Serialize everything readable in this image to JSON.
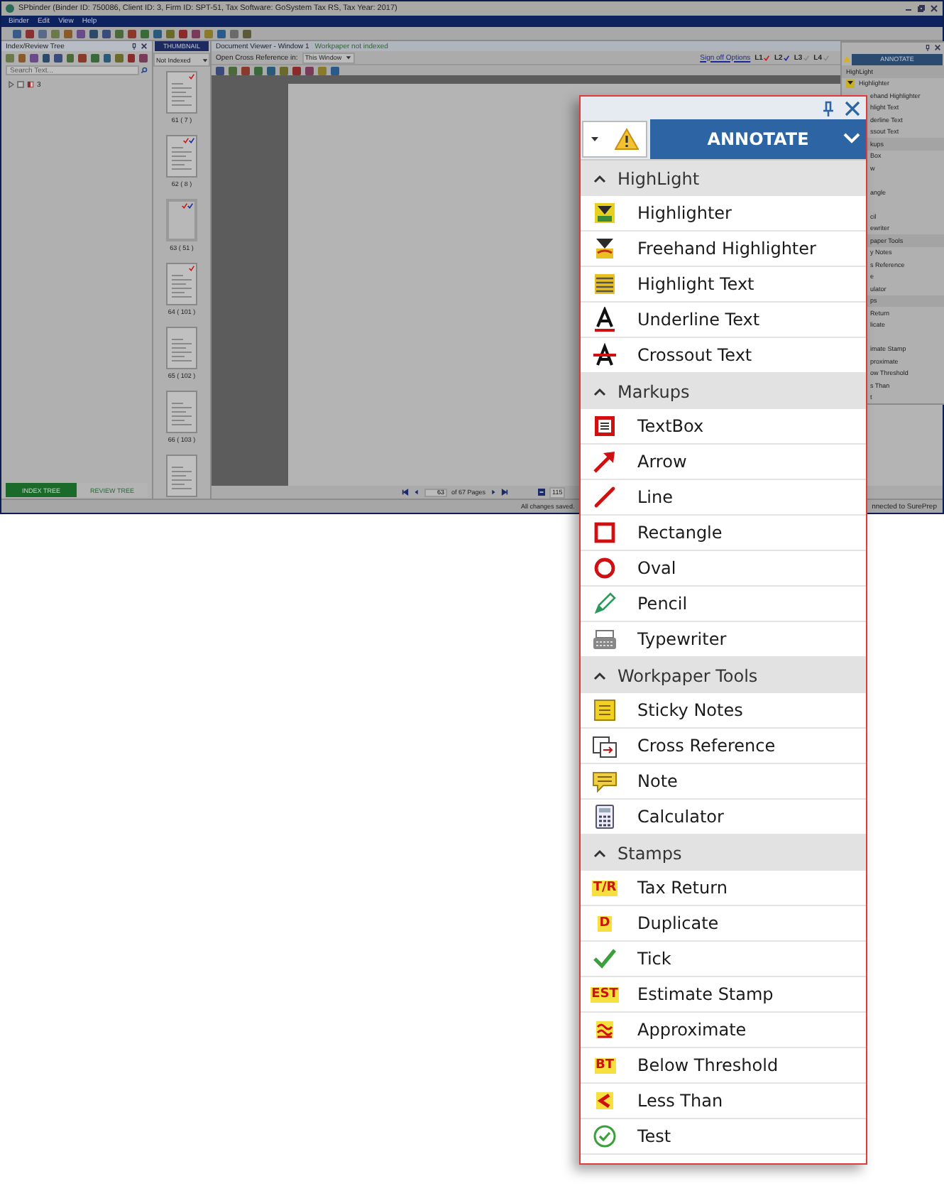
{
  "window": {
    "title": "SPbinder (Binder ID: 750086, Client ID: 3, Firm ID: SPT-51, Tax Software: GoSystem Tax RS, Tax Year: 2017)"
  },
  "menu": [
    "Binder",
    "Edit",
    "View",
    "Help"
  ],
  "index_panel": {
    "title": "Index/Review Tree",
    "search": {
      "placeholder": "Search Text..."
    },
    "tree": [
      {
        "label": "3",
        "expanded": false,
        "checked": false
      }
    ],
    "tabs": [
      {
        "label": "INDEX TREE",
        "selected": true
      },
      {
        "label": "REVIEW TREE",
        "selected": false
      }
    ]
  },
  "thumbnail_panel": {
    "tab": "THUMBNAIL",
    "filter": "Not Indexed",
    "thumbnails": [
      {
        "label": "61 ( 7 )",
        "blank": false,
        "checks": [
          {
            "color": "#c81818"
          }
        ]
      },
      {
        "label": "62 ( 8 )",
        "blank": false,
        "checks": [
          {
            "color": "#c81818"
          },
          {
            "color": "#1a2a9a"
          }
        ]
      },
      {
        "label": "63 ( 51 )",
        "blank": true,
        "checks": [
          {
            "color": "#c81818"
          },
          {
            "color": "#1a2a9a"
          }
        ]
      },
      {
        "label": "64 ( 101 )",
        "blank": false,
        "checks": [
          {
            "color": "#c81818"
          }
        ]
      },
      {
        "label": "65 ( 102 )",
        "blank": false
      },
      {
        "label": "66 ( 103 )",
        "blank": false
      },
      {
        "blank": false
      }
    ]
  },
  "viewer": {
    "title": "Document Viewer - Window 1",
    "status": "Workpaper not indexed",
    "cross_ref_label": "Open Cross Reference in:",
    "cross_ref_value": "This Window",
    "signoff_link": "Sign off Options",
    "signoffs": [
      {
        "label": "L1",
        "color": "#c81818"
      },
      {
        "label": "L2",
        "color": "#1a2a9a"
      },
      {
        "label": "L3",
        "color": "#8a8a8a"
      },
      {
        "label": "L4",
        "color": "#8a8a8a"
      }
    ],
    "page": "63",
    "page_of": "of  67 Pages",
    "zoom": "115"
  },
  "status_bar": {
    "message": "All changes saved.",
    "connection": "nnected to SurePrep"
  },
  "mini_panel": {
    "button": "ANNOTATE",
    "rows": [
      {
        "kind": "header",
        "text": "HighLight"
      },
      {
        "kind": "item",
        "text": "Highlighter"
      },
      {
        "kind": "item",
        "text": "ehand Highlighter"
      },
      {
        "kind": "item",
        "text": "hlight Text"
      },
      {
        "kind": "item",
        "text": "derline Text"
      },
      {
        "kind": "item",
        "text": "ssout Text"
      },
      {
        "kind": "header",
        "text": "kups"
      },
      {
        "kind": "item",
        "text": "Box"
      },
      {
        "kind": "item",
        "text": "w"
      },
      {
        "kind": "item"
      },
      {
        "kind": "item",
        "text": "angle"
      },
      {
        "kind": "item"
      },
      {
        "kind": "item",
        "text": "cil"
      },
      {
        "kind": "item",
        "text": "ewriter"
      },
      {
        "kind": "header",
        "text": "paper Tools"
      },
      {
        "kind": "item",
        "text": "y Notes"
      },
      {
        "kind": "item",
        "text": "s Reference"
      },
      {
        "kind": "item",
        "text": "e"
      },
      {
        "kind": "item",
        "text": "ulator"
      },
      {
        "kind": "header",
        "text": "ps"
      },
      {
        "kind": "item",
        "text": "Return"
      },
      {
        "kind": "item",
        "text": "licate"
      },
      {
        "kind": "item"
      },
      {
        "kind": "item",
        "text": "imate Stamp"
      },
      {
        "kind": "item",
        "text": "proximate"
      },
      {
        "kind": "item",
        "text": "ow Threshold"
      },
      {
        "kind": "item",
        "text": "s Than"
      },
      {
        "kind": "item",
        "text": "t"
      }
    ]
  },
  "annotate_panel": {
    "button": "ANNOTATE",
    "sections": [
      {
        "title": "HighLight",
        "expanded": true,
        "items": [
          {
            "label": "Highlighter"
          },
          {
            "label": "Freehand Highlighter"
          },
          {
            "label": "Highlight Text"
          },
          {
            "label": "Underline Text"
          },
          {
            "label": "Crossout Text"
          }
        ]
      },
      {
        "title": "Markups",
        "expanded": true,
        "items": [
          {
            "label": "TextBox"
          },
          {
            "label": "Arrow"
          },
          {
            "label": "Line"
          },
          {
            "label": "Rectangle"
          },
          {
            "label": "Oval"
          },
          {
            "label": "Pencil"
          },
          {
            "label": "Typewriter"
          }
        ]
      },
      {
        "title": "Workpaper Tools",
        "expanded": true,
        "items": [
          {
            "label": "Sticky Notes"
          },
          {
            "label": "Cross Reference"
          },
          {
            "label": "Note"
          },
          {
            "label": "Calculator"
          }
        ]
      },
      {
        "title": "Stamps",
        "expanded": true,
        "items": [
          {
            "label": "Tax Return",
            "stamp": "T/R"
          },
          {
            "label": "Duplicate",
            "stamp": "D"
          },
          {
            "label": "Tick"
          },
          {
            "label": "Estimate Stamp",
            "stamp": "EST"
          },
          {
            "label": "Approximate"
          },
          {
            "label": "Below Threshold",
            "stamp": "BT"
          },
          {
            "label": "Less Than"
          },
          {
            "label": "Test"
          }
        ]
      }
    ]
  }
}
